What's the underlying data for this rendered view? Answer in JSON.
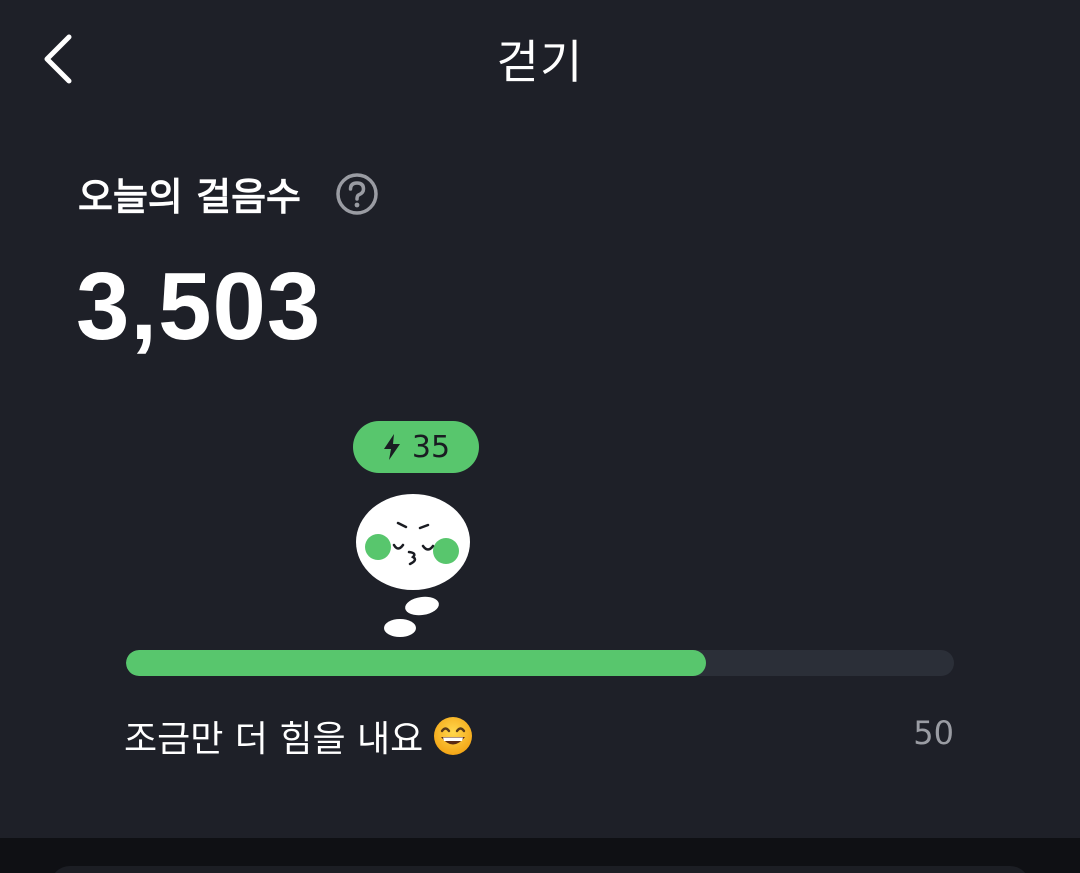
{
  "header": {
    "title": "걷기",
    "back_icon": "chevron-left-icon"
  },
  "steps": {
    "label": "오늘의 걸음수",
    "help_icon": "question-circle-icon",
    "count": "3,503"
  },
  "reward": {
    "icon": "lightning-bolt-icon",
    "points": "35"
  },
  "progress": {
    "percent": 70,
    "message": "조금만 더 힘을 내요",
    "emoji": "grinning-face-emoji",
    "goal_label": "50"
  },
  "colors": {
    "background": "#1e2028",
    "accent": "#58c66d",
    "track": "#2b2f38",
    "muted_text": "#9a9ca3"
  }
}
